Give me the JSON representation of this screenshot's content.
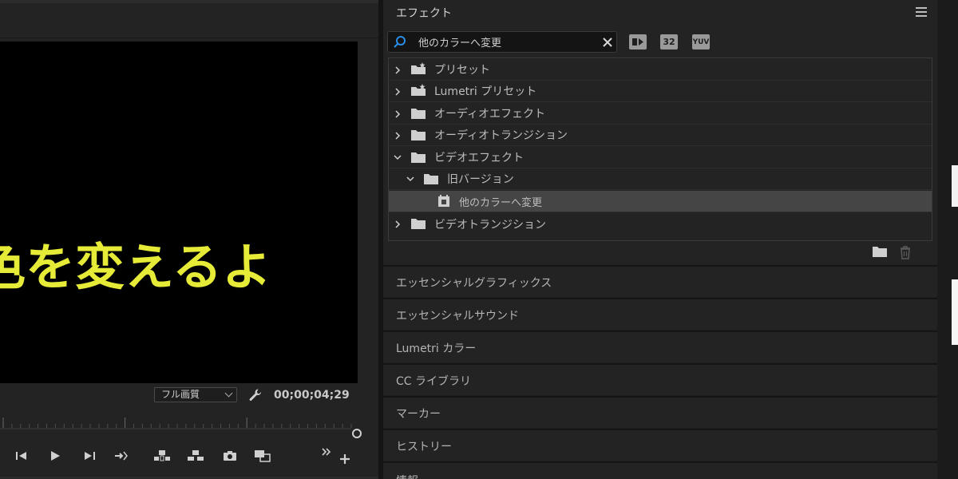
{
  "monitor": {
    "caption": "色を変えるよ",
    "quality": "フル画質",
    "timecode": "00;00;04;29"
  },
  "effects_panel": {
    "title": "エフェクト",
    "search": {
      "value": "他のカラーへ変更"
    },
    "accelerated_filters": [
      "GPU",
      "32",
      "YUV"
    ],
    "tree": [
      {
        "label": "プリセット",
        "icon": "preset-folder-icon",
        "expanded": false
      },
      {
        "label": "Lumetri プリセット",
        "icon": "preset-folder-icon",
        "expanded": false
      },
      {
        "label": "オーディオエフェクト",
        "icon": "folder-icon",
        "expanded": false
      },
      {
        "label": "オーディオトランジション",
        "icon": "folder-icon",
        "expanded": false
      },
      {
        "label": "ビデオエフェクト",
        "icon": "folder-icon",
        "expanded": true
      },
      {
        "label": "旧バージョン",
        "icon": "folder-icon",
        "expanded": true
      },
      {
        "label": "他のカラーへ変更",
        "icon": "effect-icon",
        "selected": true
      },
      {
        "label": "ビデオトランジション",
        "icon": "folder-icon",
        "expanded": false
      }
    ]
  },
  "collapsed_panels": [
    "エッセンシャルグラフィックス",
    "エッセンシャルサウンド",
    "Lumetri カラー",
    "CC ライブラリ",
    "マーカー",
    "ヒストリー",
    "情報"
  ],
  "colors": {
    "caption": "#e6eb38",
    "search_icon": "#2b8ce6",
    "selected_row": "#454545"
  }
}
